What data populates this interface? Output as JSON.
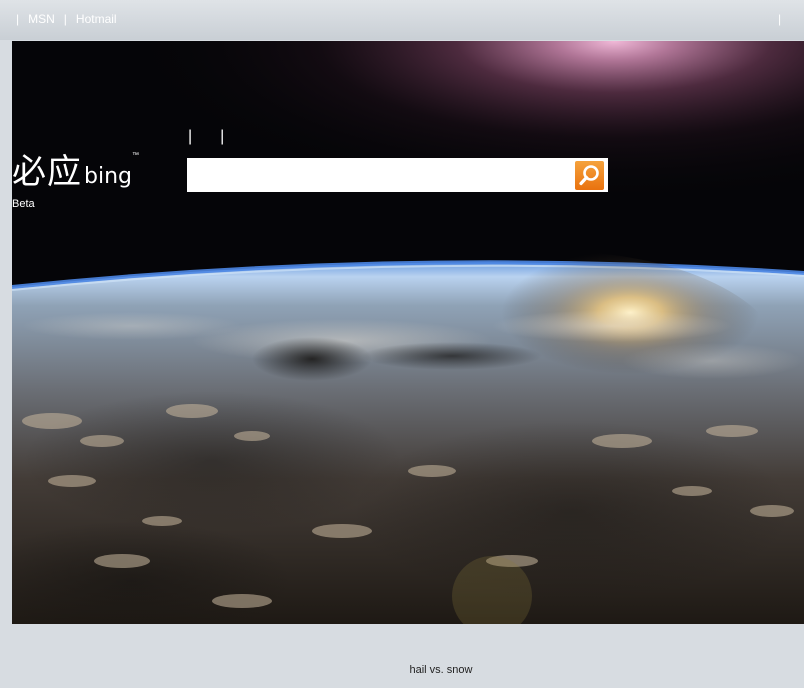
{
  "topnav": {
    "items": [
      {
        "label": "MSN"
      },
      {
        "label": "Hotmail"
      }
    ],
    "separator": "|"
  },
  "logo": {
    "chinese": "必应",
    "wordmark": "bing",
    "tagline": "Beta"
  },
  "search": {
    "value": "",
    "placeholder": "",
    "button_icon": "search-icon",
    "button_color": "#ee7a1a"
  },
  "footer": {
    "trending_query": "hail vs. snow"
  }
}
